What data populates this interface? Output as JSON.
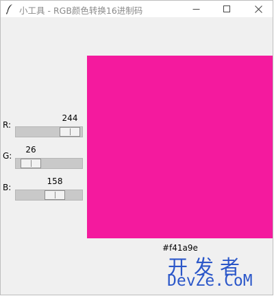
{
  "window": {
    "title": "小工具 - RGB颜色转换16进制码",
    "app_icon": "feather-icon"
  },
  "controls": {
    "minimize_icon": "minimize-icon",
    "maximize_icon": "maximize-icon",
    "close_icon": "close-icon"
  },
  "sliders": [
    {
      "label": "R:",
      "value": "244",
      "min": 0,
      "max": 255
    },
    {
      "label": "G:",
      "value": "26",
      "min": 0,
      "max": 255
    },
    {
      "label": "B:",
      "value": "158",
      "min": 0,
      "max": 255
    }
  ],
  "preview": {
    "color": "#f41a9e",
    "hex_label": "#f41a9e"
  },
  "watermark": {
    "chinese": "开发者",
    "english": "DevZe.CoM",
    "color": "#2b57c9"
  }
}
